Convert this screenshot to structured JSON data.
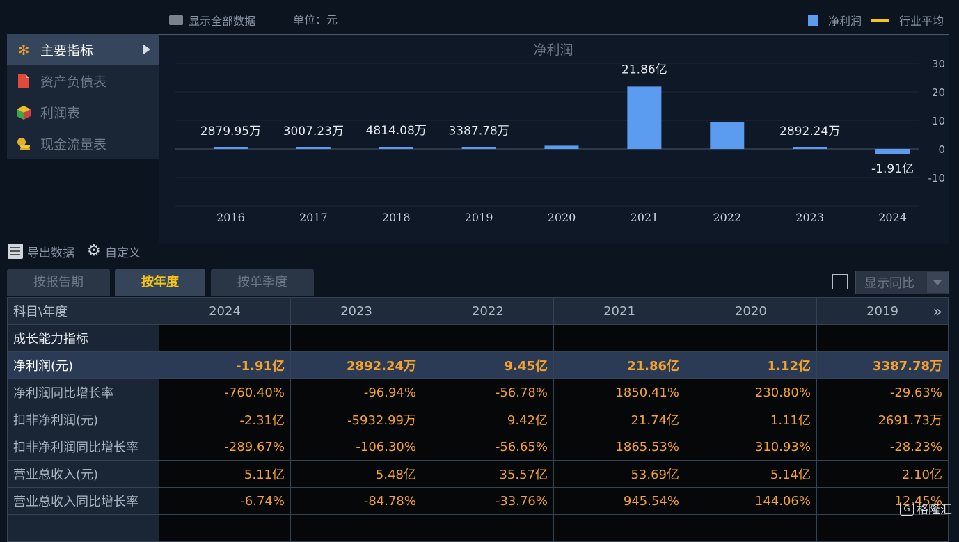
{
  "toolbar": {
    "show_all": "显示全部数据",
    "unit": "单位：元",
    "legend": {
      "series": "净利润",
      "average": "行业平均"
    }
  },
  "nav": {
    "items": [
      {
        "label": "主要指标",
        "icon": "asterisk-icon",
        "active": true
      },
      {
        "label": "资产负债表",
        "icon": "document-icon",
        "active": false
      },
      {
        "label": "利润表",
        "icon": "cube-icon",
        "active": false
      },
      {
        "label": "现金流量表",
        "icon": "coins-icon",
        "active": false
      }
    ]
  },
  "chart_data": {
    "type": "bar",
    "title": "净利润",
    "categories": [
      "2016",
      "2017",
      "2018",
      "2019",
      "2020",
      "2021",
      "2022",
      "2023",
      "2024"
    ],
    "values": [
      0.288,
      0.301,
      0.481,
      0.339,
      1.12,
      21.86,
      9.45,
      0.289,
      -1.91
    ],
    "data_labels": [
      "2879.95万",
      "3007.23万",
      "4814.08万",
      "3387.78万",
      "",
      "21.86亿",
      "",
      "2892.24万",
      "-1.91亿"
    ],
    "ylim": [
      -20,
      30
    ],
    "yticks": [
      30,
      20,
      10,
      0,
      -10
    ],
    "bar_color": "#5b9cf0",
    "grid": true
  },
  "actions": {
    "export": "导出数据",
    "customize": "自定义"
  },
  "tabs": [
    {
      "label": "按报告期",
      "active": false
    },
    {
      "label": "按年度",
      "active": true
    },
    {
      "label": "按单季度",
      "active": false
    }
  ],
  "yoy": {
    "label": "显示同比"
  },
  "table": {
    "corner": "科目\\年度",
    "columns": [
      "2024",
      "2023",
      "2022",
      "2021",
      "2020",
      "2019"
    ],
    "rows": [
      {
        "label": "成长能力指标",
        "section": true,
        "values": [
          "",
          "",
          "",
          "",
          "",
          ""
        ]
      },
      {
        "label": "净利润(元)",
        "highlight": true,
        "values": [
          "-1.91亿",
          "2892.24万",
          "9.45亿",
          "21.86亿",
          "1.12亿",
          "3387.78万"
        ]
      },
      {
        "label": "净利润同比增长率",
        "values": [
          "-760.40%",
          "-96.94%",
          "-56.78%",
          "1850.41%",
          "230.80%",
          "-29.63%"
        ]
      },
      {
        "label": "扣非净利润(元)",
        "values": [
          "-2.31亿",
          "-5932.99万",
          "9.42亿",
          "21.74亿",
          "1.11亿",
          "2691.73万"
        ]
      },
      {
        "label": "扣非净利润同比增长率",
        "values": [
          "-289.67%",
          "-106.30%",
          "-56.65%",
          "1865.53%",
          "310.93%",
          "-28.23%"
        ]
      },
      {
        "label": "营业总收入(元)",
        "values": [
          "5.11亿",
          "5.48亿",
          "35.57亿",
          "53.69亿",
          "5.14亿",
          "2.10亿"
        ]
      },
      {
        "label": "营业总收入同比增长率",
        "values": [
          "-6.74%",
          "-84.78%",
          "-33.76%",
          "945.54%",
          "144.06%",
          "12.45%"
        ]
      },
      {
        "label": "",
        "values": [
          "",
          "",
          "",
          "",
          "",
          ""
        ]
      }
    ]
  },
  "watermark": {
    "text": "格隆汇",
    "logo": "G"
  }
}
